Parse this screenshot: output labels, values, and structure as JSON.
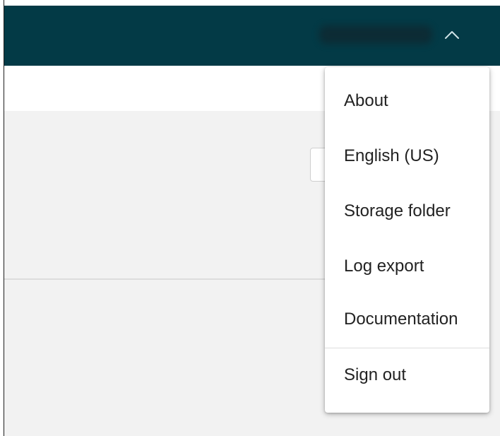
{
  "header": {
    "user_icon": "chevron-up-icon",
    "background": "#033a46"
  },
  "menu": {
    "items": [
      {
        "label": "About"
      },
      {
        "label": "English (US)"
      },
      {
        "label": "Storage folder"
      },
      {
        "label": "Log export"
      },
      {
        "label": "Documentation"
      }
    ],
    "sign_out": {
      "label": "Sign out"
    }
  }
}
